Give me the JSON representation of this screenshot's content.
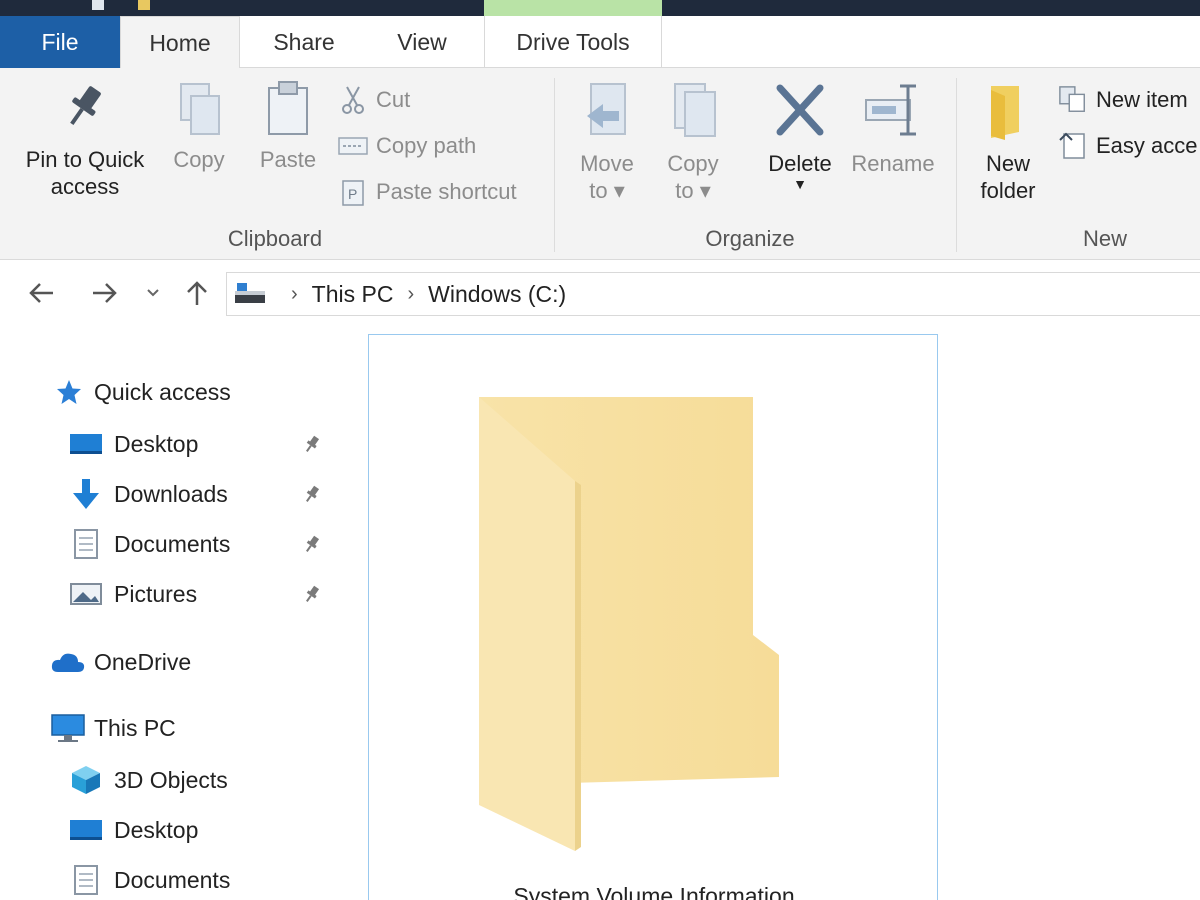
{
  "tabs": {
    "file": "File",
    "home": "Home",
    "share": "Share",
    "view": "View",
    "drive_tools": "Drive Tools"
  },
  "ribbon": {
    "clipboard": {
      "group_label": "Clipboard",
      "pin_line1": "Pin to Quick",
      "pin_line2": "access",
      "copy": "Copy",
      "paste": "Paste",
      "cut": "Cut",
      "copy_path": "Copy path",
      "paste_shortcut": "Paste shortcut"
    },
    "organize": {
      "group_label": "Organize",
      "move_line1": "Move",
      "move_line2": "to ▾",
      "copy_line1": "Copy",
      "copy_line2": "to ▾",
      "delete": "Delete",
      "rename": "Rename"
    },
    "new": {
      "group_label": "New",
      "new_folder_line1": "New",
      "new_folder_line2": "folder",
      "new_item": "New item",
      "easy_access": "Easy acce"
    }
  },
  "address": {
    "crumbs": [
      "This PC",
      "Windows (C:)"
    ]
  },
  "nav_pane": {
    "quick_access": "Quick access",
    "quick_items": [
      "Desktop",
      "Downloads",
      "Documents",
      "Pictures"
    ],
    "onedrive": "OneDrive",
    "this_pc": "This PC",
    "pc_items": [
      "3D Objects",
      "Desktop",
      "Documents"
    ]
  },
  "content": {
    "items": [
      "System Volume Information"
    ]
  },
  "colors": {
    "file_tab": "#1d5fa6",
    "titlebar": "#1f2a3c",
    "drive_tools_accent": "#b9e3a6",
    "ribbon_bg": "#f3f3f3",
    "selection_border": "#99c9ef",
    "folder": "#f7e2a4"
  }
}
